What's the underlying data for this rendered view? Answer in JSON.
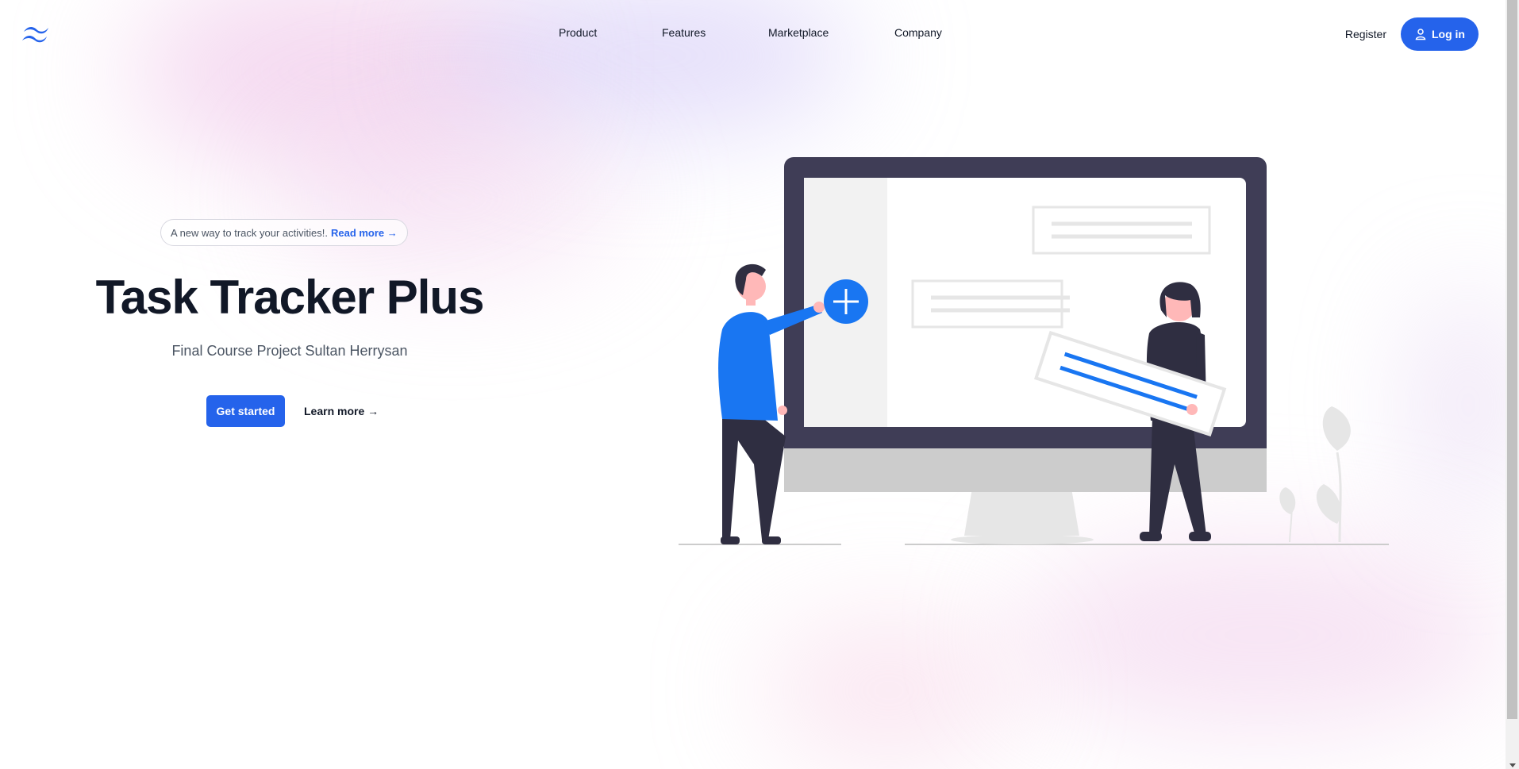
{
  "header": {
    "logo_icon": "tailwind-wave-icon",
    "nav": [
      "Product",
      "Features",
      "Marketplace",
      "Company"
    ],
    "register_label": "Register",
    "login_label": "Log in",
    "login_icon": "user-icon"
  },
  "hero": {
    "announcement_text": "A new way to track your activities!.",
    "announcement_link": "Read more →",
    "title": "Task Tracker Plus",
    "subtitle": "Final Course Project Sultan Herrysan",
    "primary_button": "Get started",
    "secondary_link": "Learn more →"
  },
  "illustration": {
    "name": "add-task-illustration",
    "colors": {
      "monitor": "#3f3d56",
      "accent": "#1976f2",
      "stand": "#cccccc",
      "panel": "#f2f2f2",
      "skin": "#ffb8b8"
    }
  },
  "colors": {
    "primary": "#2563eb",
    "text": "#111827",
    "muted": "#4b5563"
  }
}
